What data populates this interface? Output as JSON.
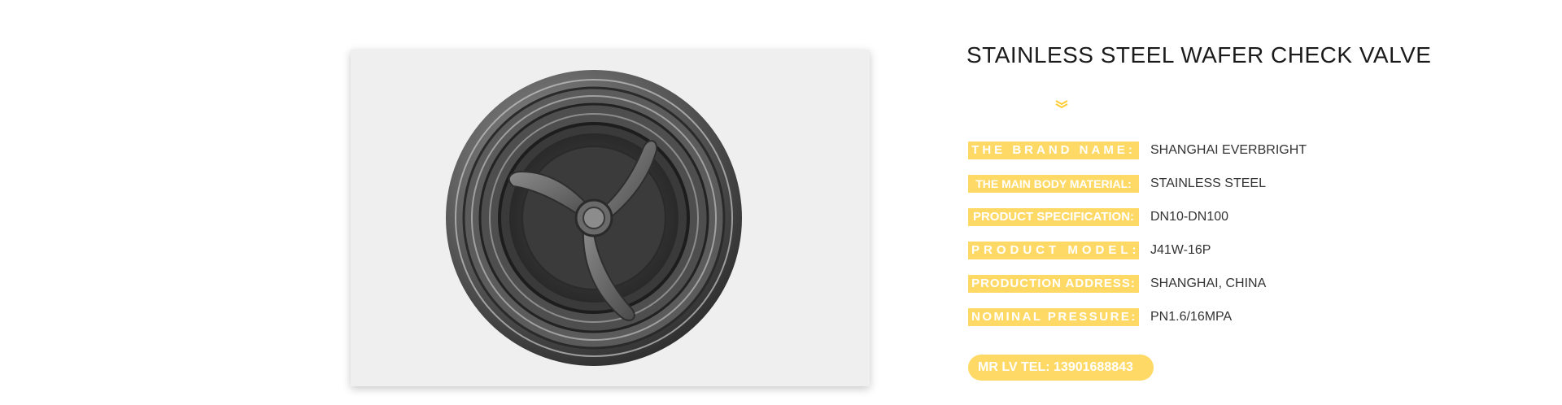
{
  "product": {
    "title": "STAINLESS STEEL WAFER CHECK VALVE",
    "image_icon": "wafer-check-valve-photo",
    "divider_icon": "double-chevron-down-icon",
    "accent_color": "#ffd966"
  },
  "specs": [
    {
      "label": "THE BRAND NAME:",
      "value": "SHANGHAI EVERBRIGHT"
    },
    {
      "label": "THE MAIN BODY MATERIAL:",
      "value": "STAINLESS STEEL"
    },
    {
      "label": "PRODUCT SPECIFICATION:",
      "value": "DN10-DN100"
    },
    {
      "label": "PRODUCT MODEL:",
      "value": "J41W-16P"
    },
    {
      "label": "PRODUCTION ADDRESS:",
      "value": "SHANGHAI, CHINA"
    },
    {
      "label": "NOMINAL PRESSURE:",
      "value": "PN1.6/16MPA"
    }
  ],
  "contact": {
    "text": "MR LV TEL: 13901688843"
  }
}
